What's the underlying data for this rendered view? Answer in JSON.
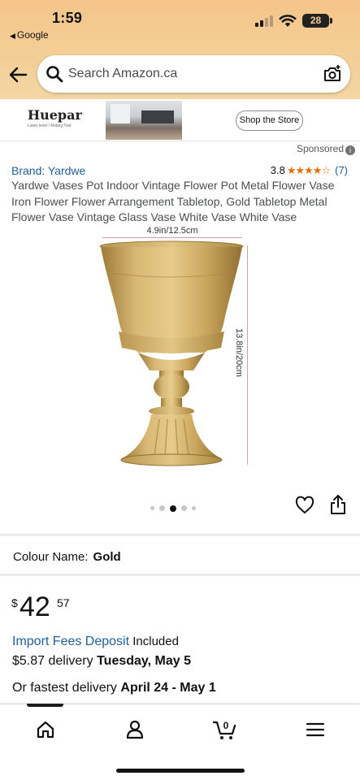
{
  "status_bar": {
    "time": "1:59",
    "back_app": "Google",
    "battery": "28"
  },
  "header": {
    "search_placeholder": "Search Amazon.ca",
    "icons": [
      "back-arrow-icon",
      "search-icon",
      "camera-scan-icon"
    ]
  },
  "banner": {
    "brand_logo": "Huepar",
    "brand_tagline": "Laser level / Rotary Tool",
    "button": "Shop the Store",
    "sponsored": "Sponsored"
  },
  "product": {
    "brand": "Brand: Yardwe",
    "rating": "3.8",
    "stars": "★★★★☆",
    "review_count": "(7)",
    "title": "Yardwe Vases Pot Indoor Vintage Flower Pot Metal Flower Vase Iron Flower Flower Arrangement Tabletop, Gold Tabletop Metal Flower Vase Vintage Glass Vase White Vase White Vase",
    "dimension_width": "4.9in/12.5cm",
    "dimension_height": "13.8in/20cm",
    "image_count": 5,
    "active_image_index": 2,
    "colour_label": "Colour Name:",
    "colour_value": "Gold",
    "price_currency": "$",
    "price_whole": "42",
    "price_fraction": "57",
    "import_fees_link": "Import Fees Deposit",
    "import_fees_status": "Included",
    "delivery_price": "$5.87 delivery",
    "delivery_date": "Tuesday, May 5",
    "fastest_prefix": "Or fastest delivery",
    "fastest_date": "April 24 - May 1"
  },
  "tabbar": {
    "cart_count": "0",
    "items": [
      "home-icon",
      "account-icon",
      "cart-icon",
      "menu-icon"
    ]
  },
  "colors": {
    "header": "#f3cf97",
    "link": "#1f5e96",
    "star": "#e2700f",
    "gold": "#c9a55c"
  }
}
